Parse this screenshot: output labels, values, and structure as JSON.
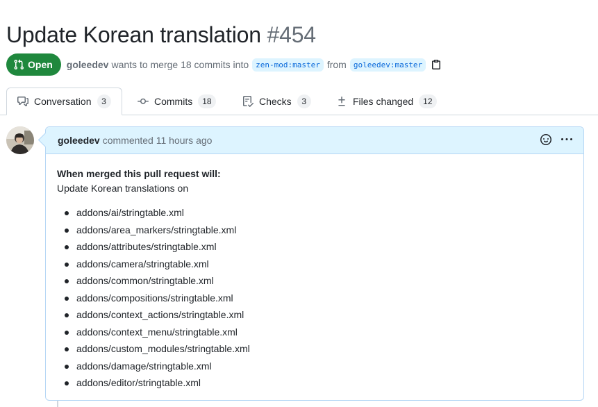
{
  "pr": {
    "title": "Update Korean translation",
    "number": "#454",
    "state_label": "Open",
    "author": "goleedev",
    "merge_text": "wants to merge 18 commits into",
    "base_ref": "zen-mod:master",
    "from_text": "from",
    "head_ref": "goleedev:master"
  },
  "tabs": [
    {
      "label": "Conversation",
      "count": "3",
      "icon": "comment-discussion-icon"
    },
    {
      "label": "Commits",
      "count": "18",
      "icon": "git-commit-icon"
    },
    {
      "label": "Checks",
      "count": "3",
      "icon": "checklist-icon"
    },
    {
      "label": "Files changed",
      "count": "12",
      "icon": "file-diff-icon"
    }
  ],
  "comment": {
    "author": "goleedev",
    "timestamp": "commented 11 hours ago",
    "lead": "When merged this pull request will:",
    "intro": "Update Korean translations on",
    "files": [
      "addons/ai/stringtable.xml",
      "addons/area_markers/stringtable.xml",
      "addons/attributes/stringtable.xml",
      "addons/camera/stringtable.xml",
      "addons/common/stringtable.xml",
      "addons/compositions/stringtable.xml",
      "addons/context_actions/stringtable.xml",
      "addons/context_menu/stringtable.xml",
      "addons/custom_modules/stringtable.xml",
      "addons/damage/stringtable.xml",
      "addons/editor/stringtable.xml"
    ]
  },
  "colors": {
    "open_green": "#1f883d",
    "link_blue": "#0969da",
    "header_blue": "#ddf4ff",
    "muted": "#656d76"
  }
}
